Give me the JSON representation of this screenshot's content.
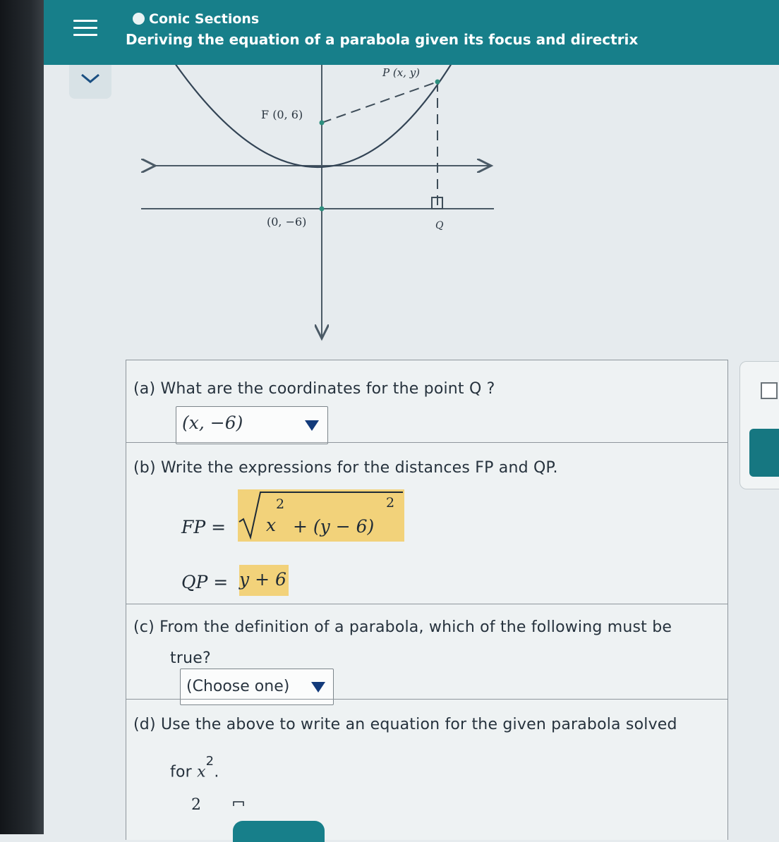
{
  "header": {
    "topic": "Conic Sections",
    "lesson": "Deriving the equation of a parabola given its focus and directrix"
  },
  "graph": {
    "labels": {
      "point_p": "P (x, y)",
      "focus": "F (0, 6)",
      "directrix_point": "(0, −6)",
      "point_q": "Q"
    }
  },
  "questions": {
    "a": {
      "tag": "(a)",
      "text": "What are the coordinates for the point Q ?",
      "answer": "(x, −6)"
    },
    "b": {
      "tag": "(b)",
      "text": "Write the expressions for the distances FP and QP.",
      "fp_label": "FP =",
      "fp_x": "x",
      "fp_exp1": "2",
      "fp_mid": "+ (y − 6)",
      "fp_exp2": "2",
      "qp_label": "QP =",
      "qp_value": "y + 6"
    },
    "c": {
      "tag": "(c)",
      "text_line1": "From the definition of a parabola, which of the following must be",
      "text_line2": "true?",
      "dropdown": "(Choose one)"
    },
    "d": {
      "tag": "(d)",
      "text_line1": "Use the above to write an equation for the given parabola solved",
      "text_for": "for",
      "var": "x",
      "exp": "2",
      "period": ".",
      "partial": "2"
    }
  },
  "colors": {
    "header": "#177f8a",
    "highlight": "#f2d27a",
    "dropdown_arrow": "#123a7a"
  }
}
